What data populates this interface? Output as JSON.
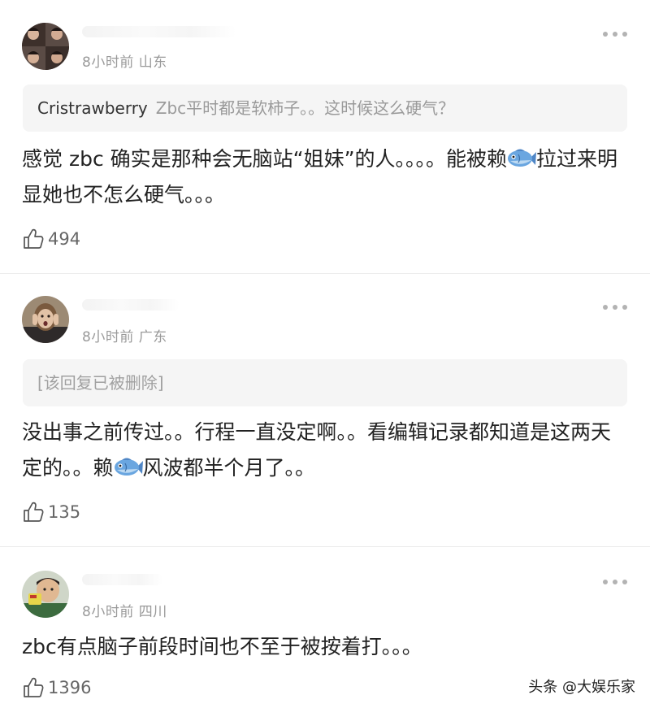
{
  "comments": [
    {
      "time_location": "8小时前 山东",
      "quote_user": "Cristrawberry",
      "quote_text": "Zbc平时都是软柿子。。这时候这么硬气？",
      "body_before_icon": "感觉 zbc 确实是那种会无脑站“姐妹”的人。。。。能被赖",
      "icon": "fish-icon",
      "body_after_icon": "拉过来明显她也不怎么硬气。。。",
      "likes": "494"
    },
    {
      "time_location": "8小时前 广东",
      "quote_deleted": "[该回复已被删除]",
      "body_before_icon": "没出事之前传过。。行程一直没定啊。。看编辑记录都知道是这两天定的。。赖",
      "icon": "fish-icon",
      "body_after_icon": "风波都半个月了。。",
      "likes": "135"
    },
    {
      "time_location": "8小时前 四川",
      "body": "zbc有点脑子前段时间也不至于被按着打。。。",
      "likes": "1396"
    }
  ],
  "watermark": "头条 @大娱乐家",
  "colors": {
    "meta": "#9a9a9a",
    "quote_bg": "#f5f5f5",
    "text": "#222222",
    "divider": "#ececec"
  }
}
